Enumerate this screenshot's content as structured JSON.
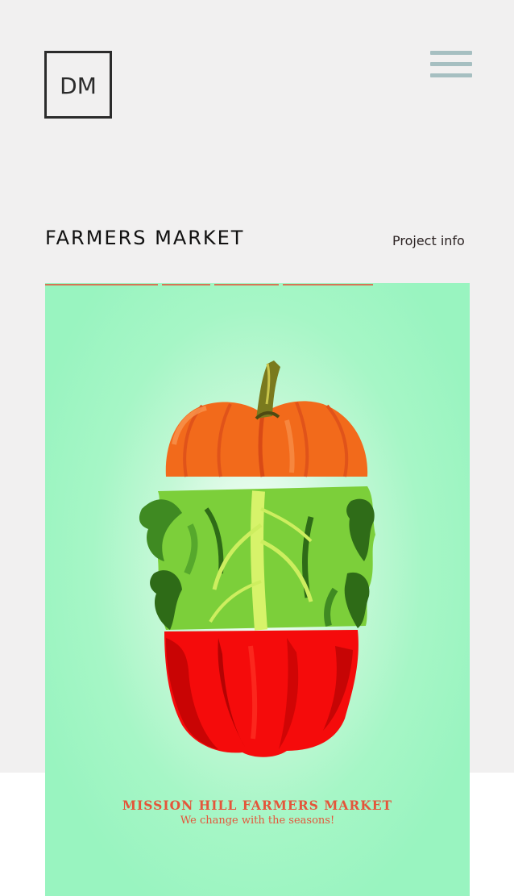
{
  "header": {
    "logo_text": "DM",
    "menu_icon": "hamburger-menu-icon"
  },
  "page": {
    "title": "FARMERS MARKET",
    "project_info_label": "Project info"
  },
  "poster": {
    "title": "MISSION HILL FARMERS MARKET",
    "subtitle": "We change with the seasons!",
    "illustration": [
      "pumpkin",
      "lettuce",
      "red-bell-pepper"
    ]
  },
  "colors": {
    "background_top": "#f1f0f0",
    "background_bottom": "#ffffff",
    "logo": "#2b2b2b",
    "menu_icon": "#a6bfc1",
    "poster_bg": "#99f4c0",
    "poster_text": "#e4553a",
    "pumpkin": "#f26a1b",
    "lettuce": "#7ccf3a",
    "pepper": "#f50b0b"
  }
}
